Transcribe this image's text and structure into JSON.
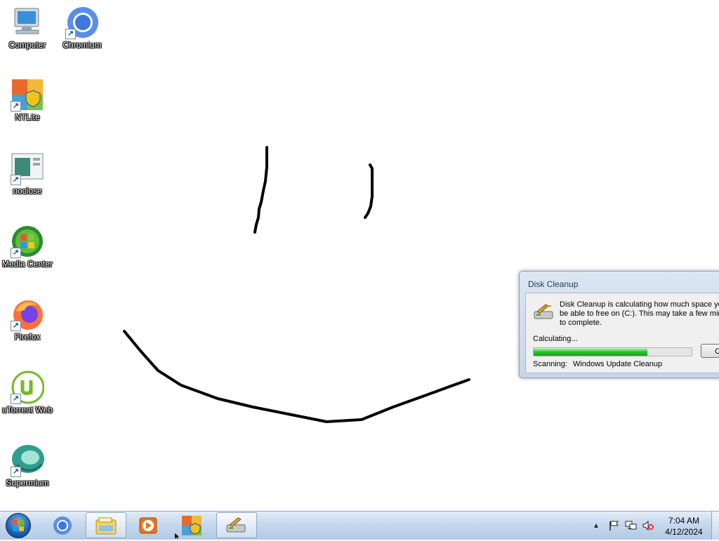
{
  "desktop": {
    "icons": [
      {
        "label": "Computer",
        "icon": "computer-icon"
      },
      {
        "label": "Chromium",
        "icon": "chromium-icon"
      },
      {
        "label": "NTLite",
        "icon": "ntlite-icon"
      },
      {
        "label": "noclose",
        "icon": "noclose-icon"
      },
      {
        "label": "Media Center",
        "icon": "media-center-icon"
      },
      {
        "label": "Firefox",
        "icon": "firefox-icon"
      },
      {
        "label": "uTorrent Web",
        "icon": "utorrent-icon"
      },
      {
        "label": "Supermium",
        "icon": "supermium-icon"
      }
    ]
  },
  "dialog": {
    "title": "Disk Cleanup",
    "message": "Disk Cleanup is calculating how much space you will be able to free on  (C:). This may take a few minutes to complete.",
    "calculating_label": "Calculating...",
    "progress": 0.72,
    "cancel_label": "Cancel",
    "scanning_label": "Scanning:",
    "scanning_item": "Windows Update Cleanup"
  },
  "taskbar": {
    "pinned": [
      "start-orb",
      "chromium-icon",
      "explorer-icon",
      "media-player-icon",
      "ntlite-icon",
      "disk-cleanup-icon"
    ],
    "tray_icons": [
      "show-hidden-icons-icon",
      "action-center-flag-icon",
      "network-icon",
      "volume-muted-icon"
    ],
    "clock_time": "7:04 AM",
    "clock_date": "4/12/2024"
  },
  "colors": {
    "taskbar_top": "#e3edf8",
    "taskbar_bottom": "#b3c9e3",
    "progress_green": "#27c427",
    "dialog_frame": "#c7d6ea"
  }
}
